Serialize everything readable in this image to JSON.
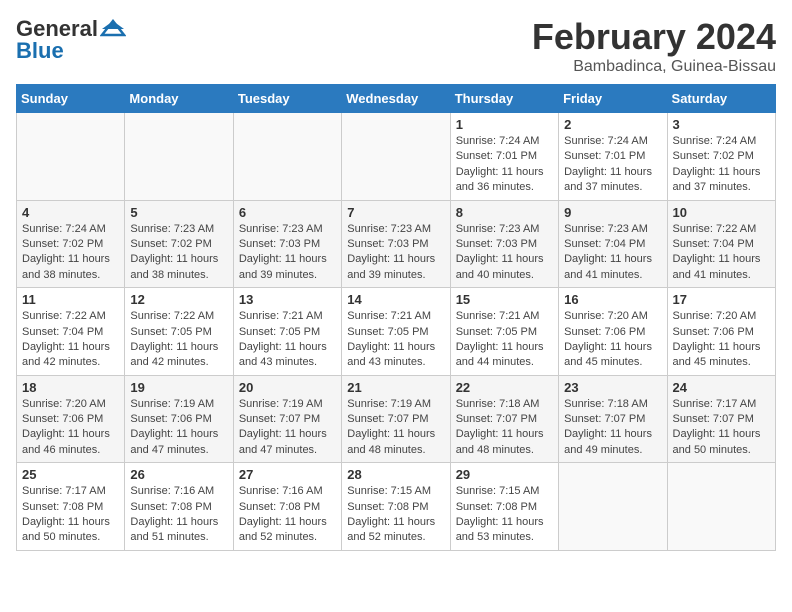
{
  "header": {
    "logo_general": "General",
    "logo_blue": "Blue",
    "title": "February 2024",
    "subtitle": "Bambadinca, Guinea-Bissau"
  },
  "calendar": {
    "days_of_week": [
      "Sunday",
      "Monday",
      "Tuesday",
      "Wednesday",
      "Thursday",
      "Friday",
      "Saturday"
    ],
    "weeks": [
      [
        {
          "day": "",
          "info": ""
        },
        {
          "day": "",
          "info": ""
        },
        {
          "day": "",
          "info": ""
        },
        {
          "day": "",
          "info": ""
        },
        {
          "day": "1",
          "info": "Sunrise: 7:24 AM\nSunset: 7:01 PM\nDaylight: 11 hours\nand 36 minutes."
        },
        {
          "day": "2",
          "info": "Sunrise: 7:24 AM\nSunset: 7:01 PM\nDaylight: 11 hours\nand 37 minutes."
        },
        {
          "day": "3",
          "info": "Sunrise: 7:24 AM\nSunset: 7:02 PM\nDaylight: 11 hours\nand 37 minutes."
        }
      ],
      [
        {
          "day": "4",
          "info": "Sunrise: 7:24 AM\nSunset: 7:02 PM\nDaylight: 11 hours\nand 38 minutes."
        },
        {
          "day": "5",
          "info": "Sunrise: 7:23 AM\nSunset: 7:02 PM\nDaylight: 11 hours\nand 38 minutes."
        },
        {
          "day": "6",
          "info": "Sunrise: 7:23 AM\nSunset: 7:03 PM\nDaylight: 11 hours\nand 39 minutes."
        },
        {
          "day": "7",
          "info": "Sunrise: 7:23 AM\nSunset: 7:03 PM\nDaylight: 11 hours\nand 39 minutes."
        },
        {
          "day": "8",
          "info": "Sunrise: 7:23 AM\nSunset: 7:03 PM\nDaylight: 11 hours\nand 40 minutes."
        },
        {
          "day": "9",
          "info": "Sunrise: 7:23 AM\nSunset: 7:04 PM\nDaylight: 11 hours\nand 41 minutes."
        },
        {
          "day": "10",
          "info": "Sunrise: 7:22 AM\nSunset: 7:04 PM\nDaylight: 11 hours\nand 41 minutes."
        }
      ],
      [
        {
          "day": "11",
          "info": "Sunrise: 7:22 AM\nSunset: 7:04 PM\nDaylight: 11 hours\nand 42 minutes."
        },
        {
          "day": "12",
          "info": "Sunrise: 7:22 AM\nSunset: 7:05 PM\nDaylight: 11 hours\nand 42 minutes."
        },
        {
          "day": "13",
          "info": "Sunrise: 7:21 AM\nSunset: 7:05 PM\nDaylight: 11 hours\nand 43 minutes."
        },
        {
          "day": "14",
          "info": "Sunrise: 7:21 AM\nSunset: 7:05 PM\nDaylight: 11 hours\nand 43 minutes."
        },
        {
          "day": "15",
          "info": "Sunrise: 7:21 AM\nSunset: 7:05 PM\nDaylight: 11 hours\nand 44 minutes."
        },
        {
          "day": "16",
          "info": "Sunrise: 7:20 AM\nSunset: 7:06 PM\nDaylight: 11 hours\nand 45 minutes."
        },
        {
          "day": "17",
          "info": "Sunrise: 7:20 AM\nSunset: 7:06 PM\nDaylight: 11 hours\nand 45 minutes."
        }
      ],
      [
        {
          "day": "18",
          "info": "Sunrise: 7:20 AM\nSunset: 7:06 PM\nDaylight: 11 hours\nand 46 minutes."
        },
        {
          "day": "19",
          "info": "Sunrise: 7:19 AM\nSunset: 7:06 PM\nDaylight: 11 hours\nand 47 minutes."
        },
        {
          "day": "20",
          "info": "Sunrise: 7:19 AM\nSunset: 7:07 PM\nDaylight: 11 hours\nand 47 minutes."
        },
        {
          "day": "21",
          "info": "Sunrise: 7:19 AM\nSunset: 7:07 PM\nDaylight: 11 hours\nand 48 minutes."
        },
        {
          "day": "22",
          "info": "Sunrise: 7:18 AM\nSunset: 7:07 PM\nDaylight: 11 hours\nand 48 minutes."
        },
        {
          "day": "23",
          "info": "Sunrise: 7:18 AM\nSunset: 7:07 PM\nDaylight: 11 hours\nand 49 minutes."
        },
        {
          "day": "24",
          "info": "Sunrise: 7:17 AM\nSunset: 7:07 PM\nDaylight: 11 hours\nand 50 minutes."
        }
      ],
      [
        {
          "day": "25",
          "info": "Sunrise: 7:17 AM\nSunset: 7:08 PM\nDaylight: 11 hours\nand 50 minutes."
        },
        {
          "day": "26",
          "info": "Sunrise: 7:16 AM\nSunset: 7:08 PM\nDaylight: 11 hours\nand 51 minutes."
        },
        {
          "day": "27",
          "info": "Sunrise: 7:16 AM\nSunset: 7:08 PM\nDaylight: 11 hours\nand 52 minutes."
        },
        {
          "day": "28",
          "info": "Sunrise: 7:15 AM\nSunset: 7:08 PM\nDaylight: 11 hours\nand 52 minutes."
        },
        {
          "day": "29",
          "info": "Sunrise: 7:15 AM\nSunset: 7:08 PM\nDaylight: 11 hours\nand 53 minutes."
        },
        {
          "day": "",
          "info": ""
        },
        {
          "day": "",
          "info": ""
        }
      ]
    ]
  }
}
